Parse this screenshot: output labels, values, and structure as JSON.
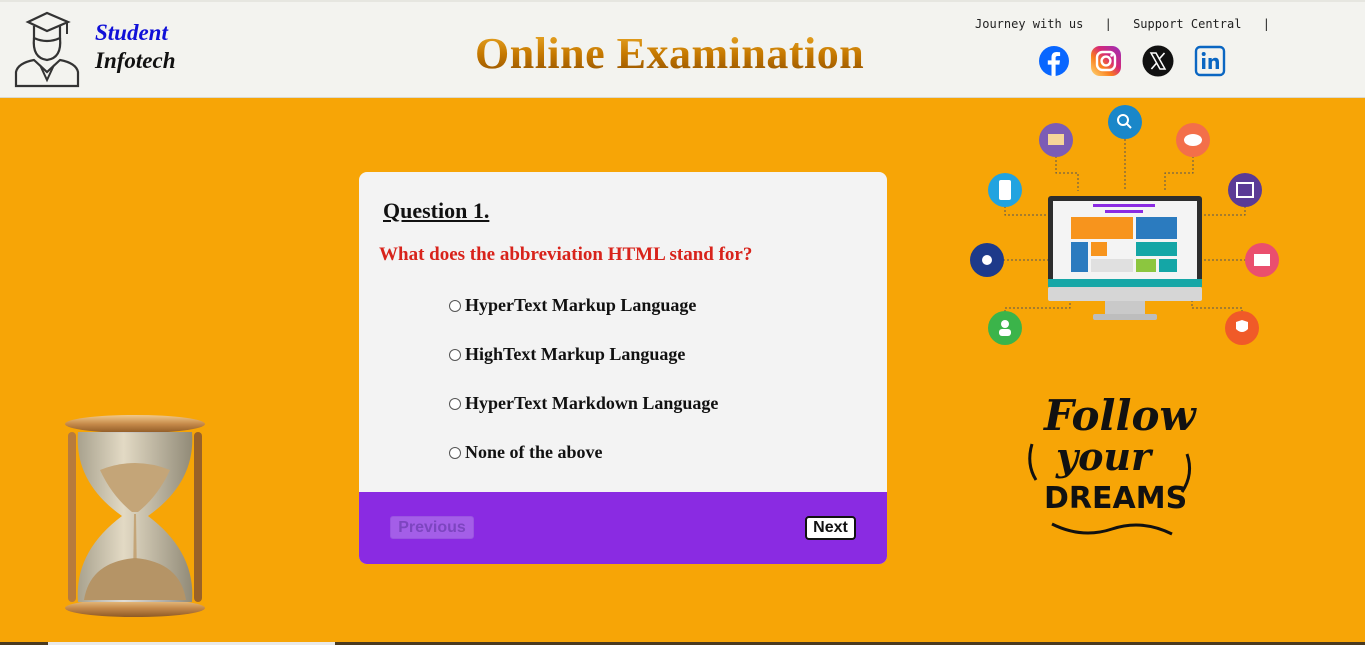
{
  "header": {
    "brand_line1": "Student",
    "brand_line2": "Infotech",
    "title": "Online Examination",
    "links": [
      "Journey with us",
      "Support Central"
    ],
    "separator": "|"
  },
  "social_icons": [
    "facebook-icon",
    "instagram-icon",
    "x-icon",
    "linkedin-icon"
  ],
  "quiz": {
    "question_number": "Question 1.",
    "question_text": "What does the abbreviation HTML stand for?",
    "options": [
      "HyperText Markup Language",
      "HighText Markup Language",
      "HyperText Markdown Language",
      "None of the above"
    ],
    "previous_label": "Previous",
    "next_label": "Next"
  },
  "decor": {
    "dreams_text": [
      "Follow",
      "your",
      "DREAMS"
    ]
  },
  "colors": {
    "background": "#f7a506",
    "header_bg": "#f3f3ef",
    "card_bg": "#f3f3f3",
    "footer_purple": "#8a2be2",
    "question_red": "#d8231b",
    "brand_blue": "#1010d8"
  }
}
